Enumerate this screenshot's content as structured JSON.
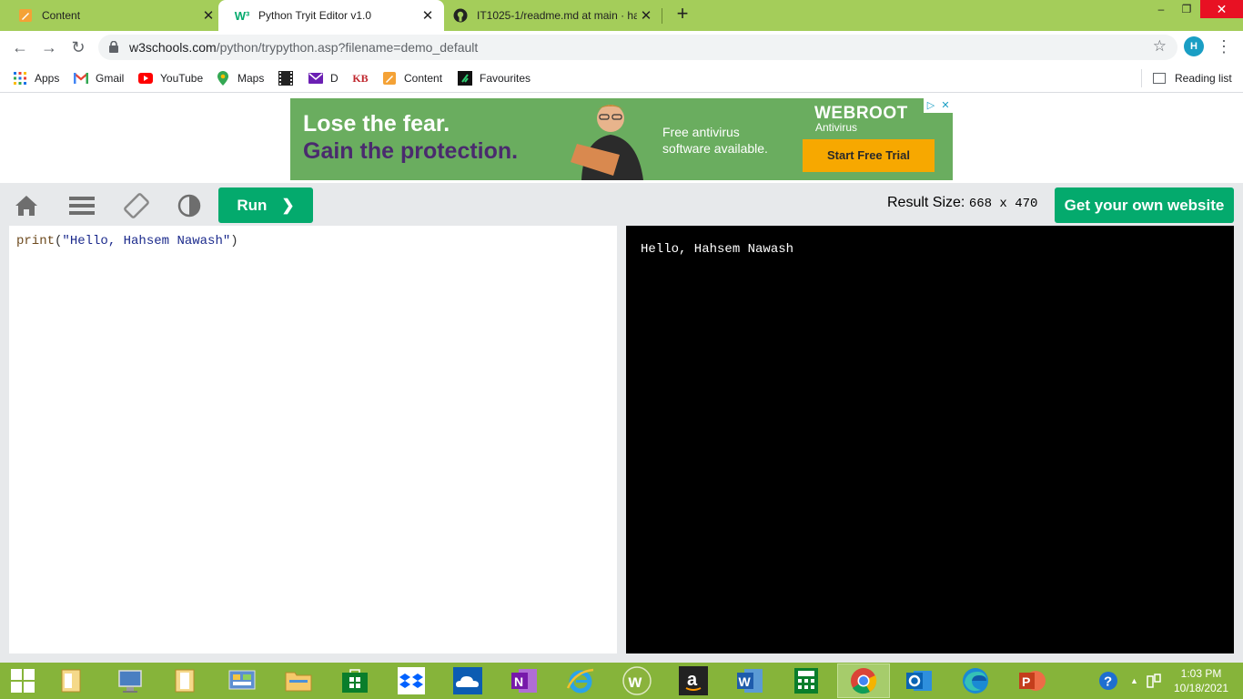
{
  "tabs": [
    {
      "title": "Content",
      "close": "✕"
    },
    {
      "title": "Python Tryit Editor v1.0",
      "close": "✕"
    },
    {
      "title": "IT1025-1/readme.md at main · ha",
      "close": "✕"
    }
  ],
  "new_tab": "+",
  "window_controls": {
    "minimize": "–",
    "restore": "❐",
    "close": "✕"
  },
  "address": {
    "host": "w3schools.com",
    "path": "/python/trypython.asp?filename=demo_default"
  },
  "profile_initial": "H",
  "bookmarks": [
    {
      "label": "Apps",
      "icon": "apps-grid-icon"
    },
    {
      "label": "Gmail",
      "icon": "gmail-icon"
    },
    {
      "label": "YouTube",
      "icon": "youtube-icon"
    },
    {
      "label": "Maps",
      "icon": "maps-icon"
    },
    {
      "label": "",
      "icon": "film-icon"
    },
    {
      "label": "D",
      "icon": "mail-icon"
    },
    {
      "label": "",
      "icon": "kb-icon",
      "icon_text": "KB"
    },
    {
      "label": "Content",
      "icon": "pencil-icon"
    },
    {
      "label": "Favourites",
      "icon": "favourites-icon"
    }
  ],
  "reading_list": "Reading list",
  "ad": {
    "headline_1": "Lose the fear.",
    "headline_2": "Gain the protection.",
    "body_line_1": "Free antivirus",
    "body_line_2": "software available.",
    "brand": "WEBROOT",
    "brand_sub": "Antivirus",
    "cta": "Start Free Trial"
  },
  "editor_toolbar": {
    "run_label": "Run",
    "result_size_label": "Result Size:",
    "result_size_value": "668 x 470",
    "get_website_label": "Get your own website"
  },
  "code": {
    "fn": "print",
    "open": "(",
    "string": "\"Hello, Hahsem Nawash\"",
    "close": ")"
  },
  "output_text": "Hello, Hahsem Nawash",
  "clock": {
    "time": "1:03 PM",
    "date": "10/18/2021"
  },
  "colors": {
    "tabstrip": "#a4cd5a",
    "w3_green": "#04aa6d",
    "taskbar": "#86b43a",
    "result_bg": "#000000"
  }
}
